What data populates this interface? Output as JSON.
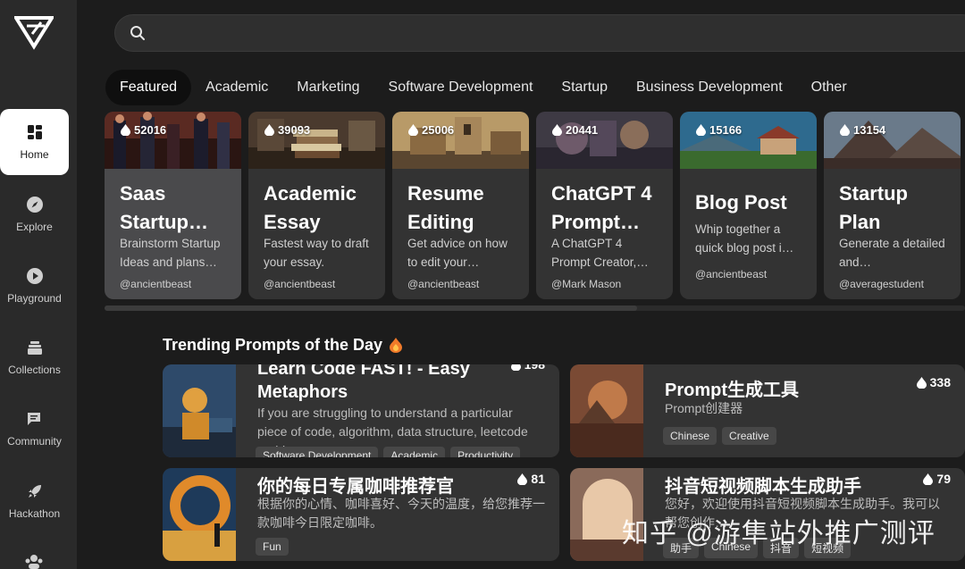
{
  "sidebar": {
    "items": [
      {
        "label": "Home",
        "icon": "home-icon",
        "active": true
      },
      {
        "label": "Explore",
        "icon": "compass-icon"
      },
      {
        "label": "Playground",
        "icon": "play-icon"
      },
      {
        "label": "Collections",
        "icon": "stack-icon"
      },
      {
        "label": "Community",
        "icon": "chat-icon"
      },
      {
        "label": "Hackathon",
        "icon": "rocket-icon"
      }
    ]
  },
  "search": {
    "placeholder": ""
  },
  "tabs": [
    "Featured",
    "Academic",
    "Marketing",
    "Software Development",
    "Startup",
    "Business Development",
    "Other"
  ],
  "featured": [
    {
      "count": "52016",
      "title": "Saas Startup…",
      "desc": "Brainstorm Startup Ideas and plans…",
      "author": "@ancientbeast"
    },
    {
      "count": "39093",
      "title": "Academic Essay",
      "desc": "Fastest way to draft your essay.",
      "author": "@ancientbeast"
    },
    {
      "count": "25006",
      "title": "Resume Editing",
      "desc": "Get advice on how to edit your…",
      "author": "@ancientbeast"
    },
    {
      "count": "20441",
      "title": "ChatGPT 4 Prompt…",
      "desc": "A ChatGPT 4 Prompt Creator,…",
      "author": "@Mark Mason"
    },
    {
      "count": "15166",
      "title": "Blog Post",
      "desc": "Whip together a quick blog post i…",
      "author": "@ancientbeast"
    },
    {
      "count": "13154",
      "title": "Startup Plan",
      "desc": "Generate a detailed and…",
      "author": "@averagestudent"
    }
  ],
  "trending": {
    "title": "Trending Prompts of the Day",
    "items": [
      {
        "title_line1": "Learn Code FAST! - Easy",
        "title_line2": "Metaphors",
        "count": "198",
        "desc": "If you are struggling to understand a particular piece of code, algorithm, data structure, leetcode problem,…",
        "tags": [
          "Software Development",
          "Academic",
          "Productivity"
        ]
      },
      {
        "title": "Prompt生成工具",
        "count": "338",
        "desc": "Prompt创建器",
        "tags": [
          "Chinese",
          "Creative"
        ]
      },
      {
        "title": "你的每日专属咖啡推荐官",
        "count": "81",
        "desc": "根据你的心情、咖啡喜好、今天的温度，给您推荐一款咖啡今日限定咖啡。",
        "tags": [
          "Fun"
        ]
      },
      {
        "title": "抖音短视频脚本生成助手",
        "count": "79",
        "desc": "您好，欢迎使用抖音短视频脚本生成助手。我可以帮您创作…",
        "tags": [
          "助手",
          "Chinese",
          "抖音",
          "短视频"
        ]
      }
    ]
  },
  "watermark": "知乎 @游隼站外推广测评",
  "colors": {
    "accent": "#ffffff",
    "card": "#333333",
    "sidebar": "#2a2a2a",
    "bg": "#1c1c1c"
  }
}
